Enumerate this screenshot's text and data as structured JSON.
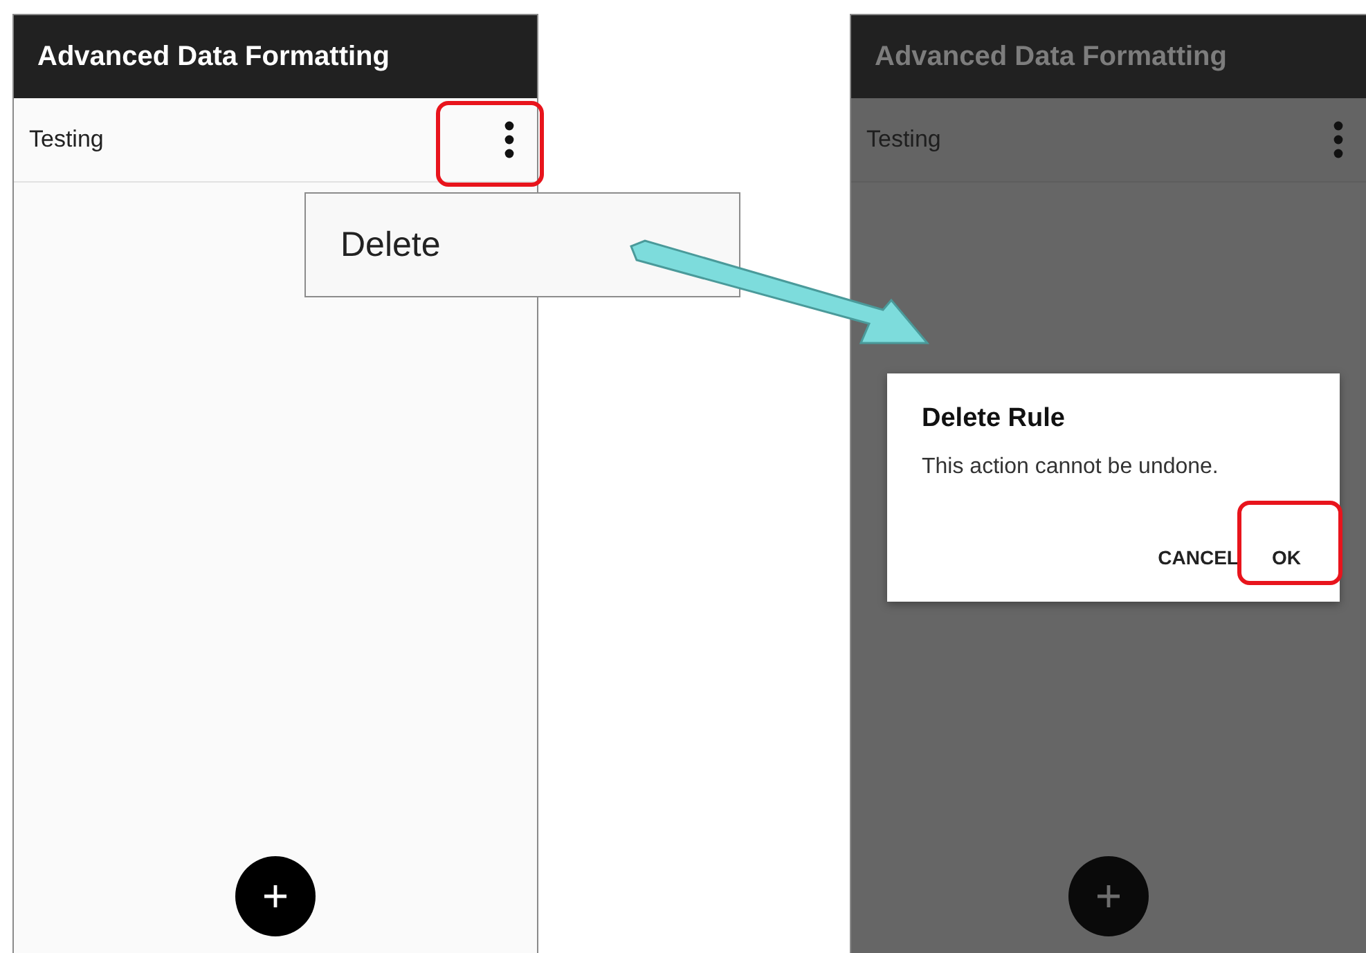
{
  "left_screen": {
    "dimmed": false,
    "title": "Advanced Data Formatting",
    "rule_item": {
      "label": "Testing",
      "menu_highlighted": true
    },
    "popup_menu": {
      "items": [
        "Delete"
      ]
    }
  },
  "right_screen": {
    "dimmed": true,
    "title": "Advanced Data Formatting",
    "rule_item": {
      "label": "Testing",
      "menu_highlighted": false
    },
    "dialog": {
      "title": "Delete Rule",
      "message": "This action cannot be undone.",
      "buttons": [
        {
          "label": "CANCEL",
          "highlighted": false
        },
        {
          "label": "OK",
          "highlighted": true
        }
      ]
    }
  }
}
